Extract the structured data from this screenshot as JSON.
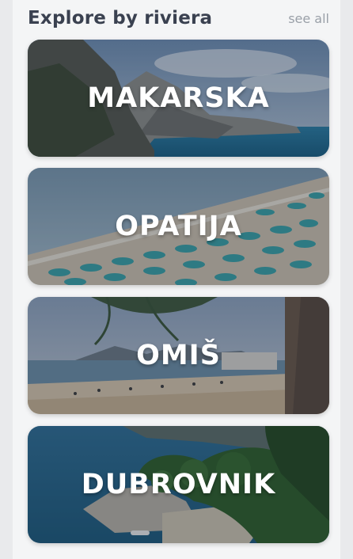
{
  "section": {
    "title": "Explore by riviera",
    "see_all_label": "see all"
  },
  "rivieras": [
    {
      "label": "MAKARSKA",
      "scene": "mountain-coast"
    },
    {
      "label": "OPATIJA",
      "scene": "crowded-beach"
    },
    {
      "label": "OMIŠ",
      "scene": "sandy-beach-palms"
    },
    {
      "label": "DUBROVNIK",
      "scene": "pine-cove"
    }
  ]
}
